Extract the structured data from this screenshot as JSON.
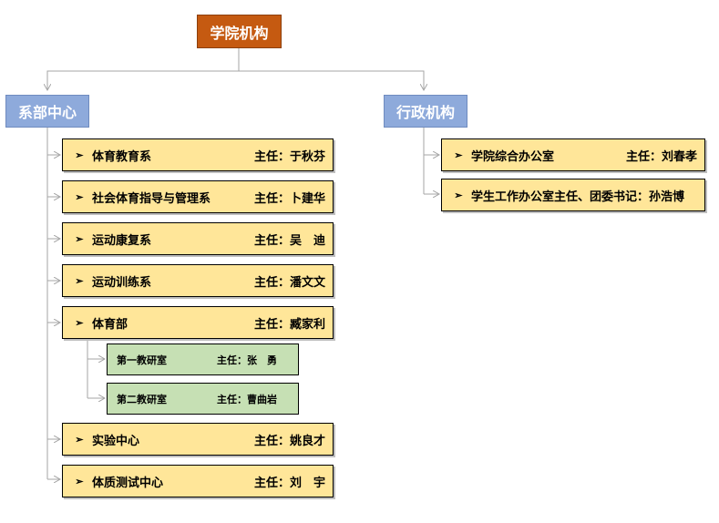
{
  "root": {
    "label": "学院机构"
  },
  "departments": {
    "label": "系部中心",
    "items": [
      {
        "name": "体育教育系",
        "head": "主任：于秋芬"
      },
      {
        "name": "社会体育指导与管理系",
        "head": "主任：卜建华"
      },
      {
        "name": "运动康复系",
        "head": "主任：吴　迪"
      },
      {
        "name": "运动训练系",
        "head": "主任：潘文文"
      },
      {
        "name": "体育部",
        "head": "主任：臧家利"
      },
      {
        "name": "实验中心",
        "head": "主任：姚良才"
      },
      {
        "name": "体质测试中心",
        "head": "主任：刘　宇"
      }
    ],
    "sub_items": [
      {
        "name": "第一教研室",
        "head": "主任：张　勇"
      },
      {
        "name": "第二教研室",
        "head": "主任：曹曲岩"
      }
    ]
  },
  "admin": {
    "label": "行政机构",
    "items": [
      {
        "name": "学院综合办公室",
        "head": "主任：刘春孝"
      },
      {
        "name": "学生工作办公室主任、团委书记：孙浩博",
        "head": ""
      }
    ]
  },
  "colors": {
    "root_fill": "#c55a11",
    "level1_fill": "#8eaadb",
    "item_fill": "#ffe699",
    "sub_fill": "#c6e0b4",
    "connector": "#a6a6a6"
  },
  "bullet_glyph": "➢"
}
